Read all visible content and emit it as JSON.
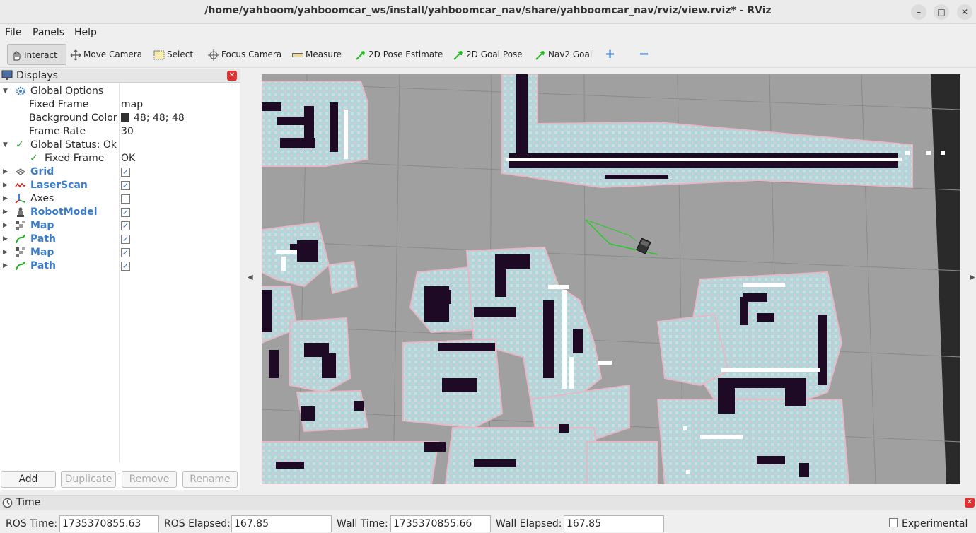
{
  "window": {
    "title": "/home/yahboom/yahboomcar_ws/install/yahboomcar_nav/share/yahboomcar_nav/rviz/view.rviz* - RViz",
    "minimize": "–",
    "maximize": "□",
    "close": "✕"
  },
  "menu": {
    "file": "File",
    "panels": "Panels",
    "help": "Help"
  },
  "toolbar": {
    "interact": "Interact",
    "move_camera": "Move Camera",
    "select": "Select",
    "focus_camera": "Focus Camera",
    "measure": "Measure",
    "pose_estimate": "2D Pose Estimate",
    "goal_pose": "2D Goal Pose",
    "nav2_goal": "Nav2 Goal",
    "add_tool": "+",
    "remove_tool": "−"
  },
  "displays": {
    "title": "Displays",
    "global_options": "Global Options",
    "fixed_frame_label": "Fixed Frame",
    "fixed_frame_value": "map",
    "background_color_label": "Background Color",
    "background_color_value": "48; 48; 48",
    "frame_rate_label": "Frame Rate",
    "frame_rate_value": "30",
    "global_status": "Global Status: Ok",
    "status_fixed_frame_label": "Fixed Frame",
    "status_fixed_frame_value": "OK",
    "items": [
      {
        "label": "Grid",
        "checked": true
      },
      {
        "label": "LaserScan",
        "checked": true
      },
      {
        "label": "Axes",
        "checked": false
      },
      {
        "label": "RobotModel",
        "checked": true
      },
      {
        "label": "Map",
        "checked": true
      },
      {
        "label": "Path",
        "checked": true
      },
      {
        "label": "Map",
        "checked": true
      },
      {
        "label": "Path",
        "checked": true
      }
    ],
    "buttons": {
      "add": "Add",
      "duplicate": "Duplicate",
      "remove": "Remove",
      "rename": "Rename"
    }
  },
  "time": {
    "title": "Time",
    "ros_time_label": "ROS Time:",
    "ros_time_value": "1735370855.63",
    "ros_elapsed_label": "ROS Elapsed:",
    "ros_elapsed_value": "167.85",
    "wall_time_label": "Wall Time:",
    "wall_time_value": "1735370855.66",
    "wall_elapsed_label": "Wall Elapsed:",
    "wall_elapsed_value": "167.85",
    "experimental_label": "Experimental"
  },
  "colors": {
    "map_free": "#a0a0a0",
    "map_inflation": "#b2d6d8",
    "map_obstacle": "#1e0a24",
    "laser_points": "#ffffff",
    "path": "#22cc22",
    "link_blue": "#3a7cc9"
  }
}
